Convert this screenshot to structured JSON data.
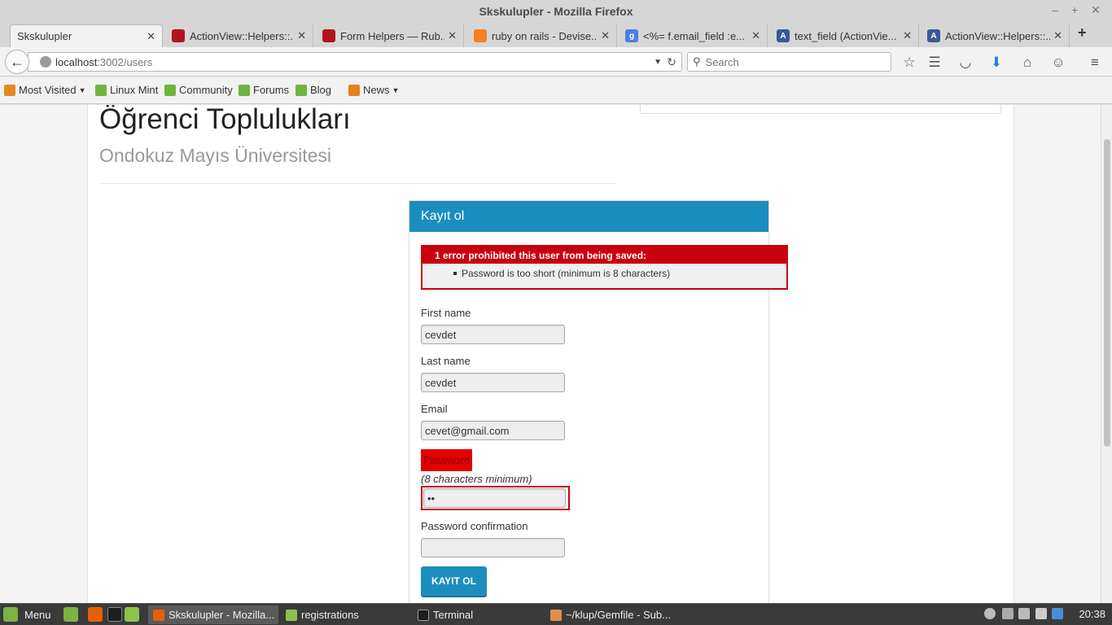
{
  "window": {
    "title": "Skskulupler - Mozilla Firefox"
  },
  "tabs": [
    {
      "label": "Skskulupler",
      "icon": "none",
      "active": true
    },
    {
      "label": "ActionView::Helpers::...",
      "icon": "rails-icon"
    },
    {
      "label": "Form Helpers — Rub...",
      "icon": "rails-icon"
    },
    {
      "label": "ruby on rails - Devise...",
      "icon": "stackoverflow-icon"
    },
    {
      "label": "<%= f.email_field :e...",
      "icon": "google-icon"
    },
    {
      "label": "text_field (ActionVie...",
      "icon": "apidock-icon"
    },
    {
      "label": "ActionView::Helpers::...",
      "icon": "apidock-icon"
    }
  ],
  "nav": {
    "url_host": "localhost",
    "url_path": ":3002/users",
    "search_placeholder": "Search"
  },
  "bookmarks": [
    {
      "label": "Most Visited",
      "icon": "most-visited-icon",
      "dropdown": true
    },
    {
      "label": "Linux Mint",
      "icon": "mint-icon"
    },
    {
      "label": "Community",
      "icon": "mint-icon"
    },
    {
      "label": "Forums",
      "icon": "mint-icon"
    },
    {
      "label": "Blog",
      "icon": "mint-icon"
    },
    {
      "label": "News",
      "icon": "rss-icon",
      "dropdown": true
    }
  ],
  "page": {
    "heading": "Öğrenci Toplulukları",
    "subheading": "Ondokuz Mayıs Üniversitesi",
    "panel_title": "Kayıt ol",
    "error": {
      "header": "1 error prohibited this user from being saved:",
      "items": [
        "Password is too short (minimum is 8 characters)"
      ]
    },
    "form": {
      "first_name_label": "First name",
      "first_name_value": "cevdet",
      "last_name_label": "Last name",
      "last_name_value": "cevdet",
      "email_label": "Email",
      "email_value": "cevet@gmail.com",
      "password_label": "Password",
      "password_hint": "(8 characters minimum)",
      "password_value": "ce",
      "password_confirmation_label": "Password confirmation",
      "password_confirmation_value": "",
      "submit_label": "KAYIT OL"
    }
  },
  "taskbar": {
    "menu_label": "Menu",
    "tasks": [
      {
        "label": "Skskulupler - Mozilla...",
        "active": true
      },
      {
        "label": "registrations"
      },
      {
        "label": "Terminal"
      },
      {
        "label": "~/klup/Gemfile - Sub..."
      }
    ],
    "clock": "20:38"
  },
  "colors": {
    "accent": "#1b8ebf",
    "error": "#c9000e"
  }
}
